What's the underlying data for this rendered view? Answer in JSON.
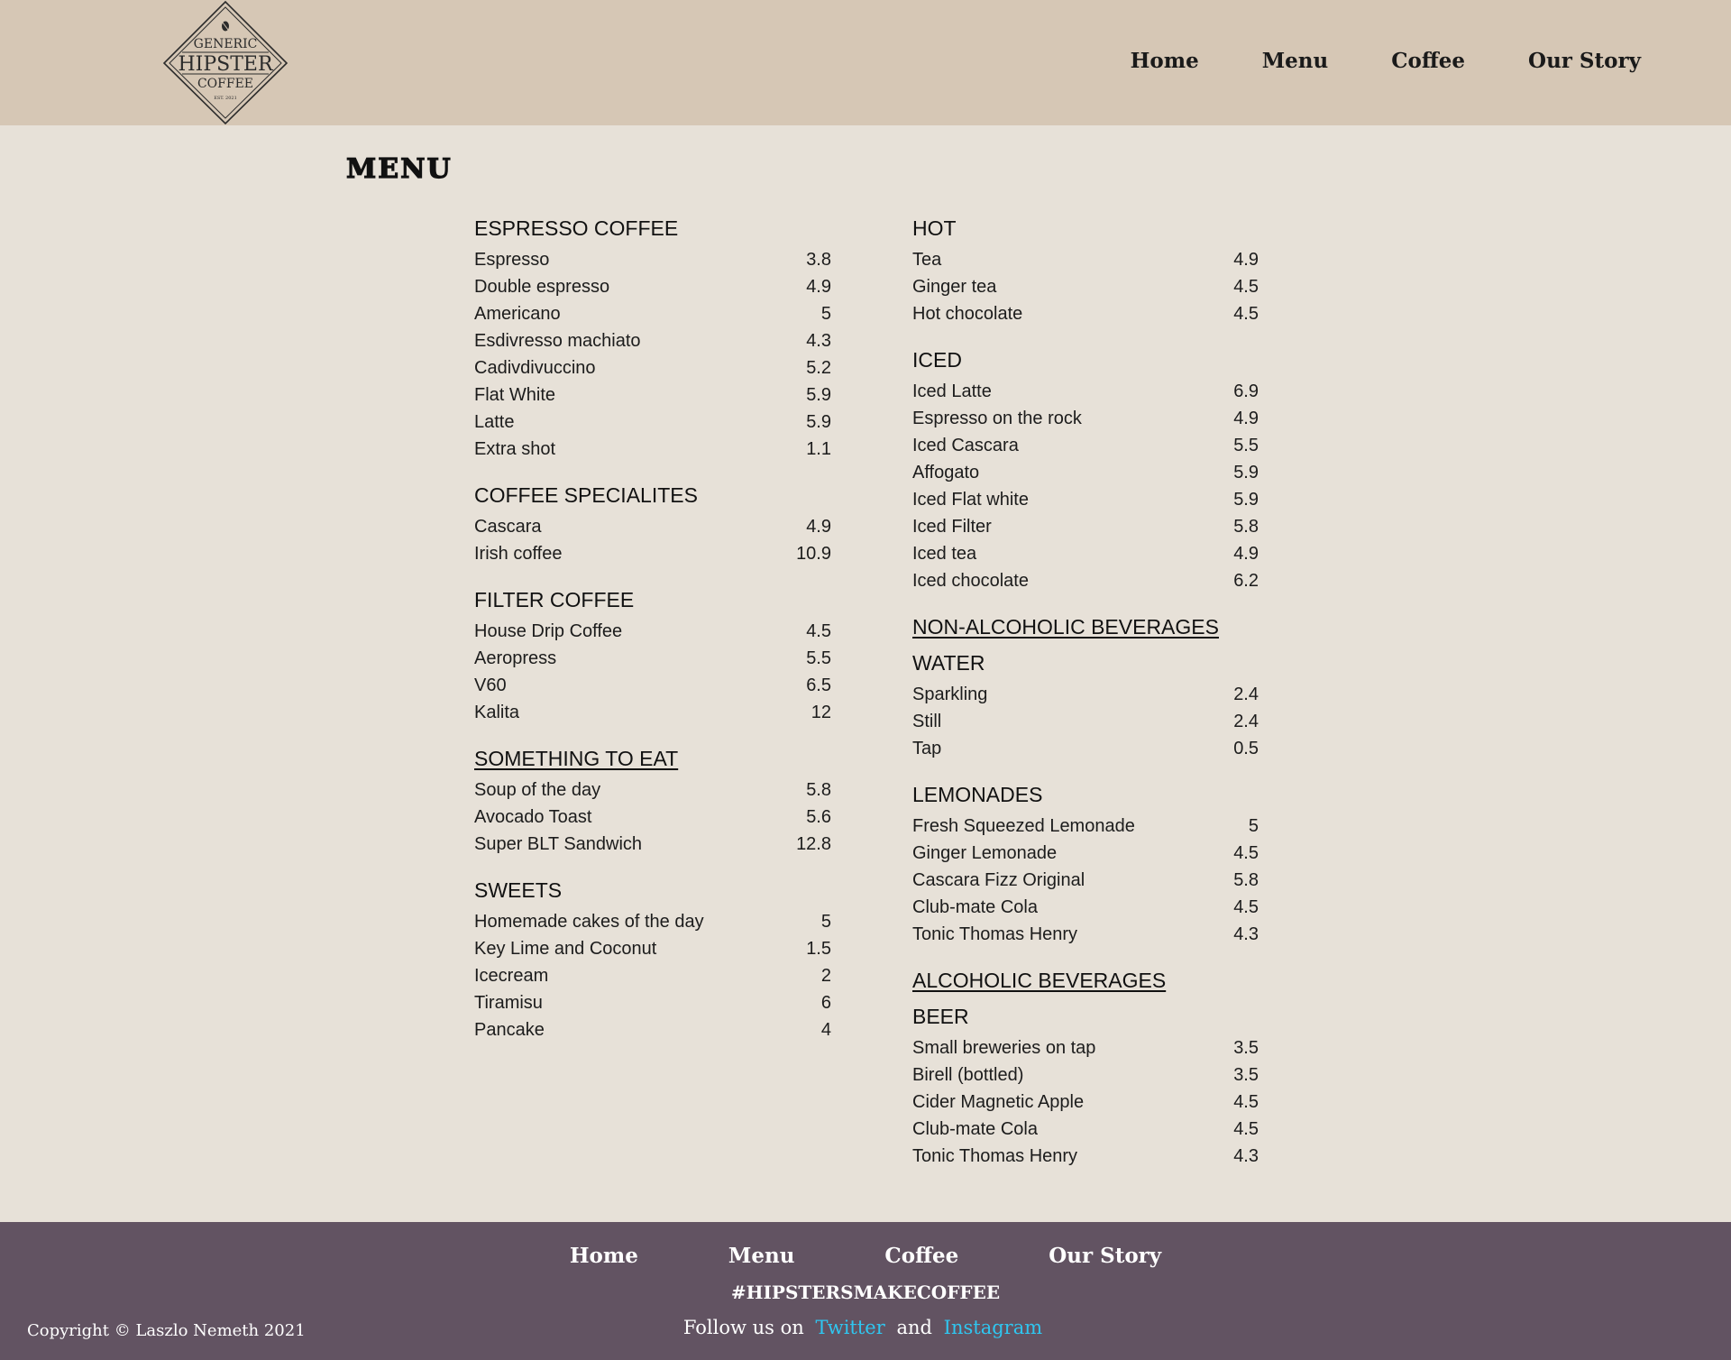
{
  "logo": {
    "line1": "GENERIC",
    "line2": "HIPSTER",
    "line3": "COFFEE",
    "est": "EST. 2021"
  },
  "nav": [
    "Home",
    "Menu",
    "Coffee",
    "Our Story"
  ],
  "title": "MENU",
  "left_column": [
    {
      "heading": "ESPRESSO COFFEE",
      "style": "plain",
      "items": [
        {
          "name": "Espresso",
          "price": "3.8"
        },
        {
          "name": "Double espresso",
          "price": "4.9"
        },
        {
          "name": "Americano",
          "price": "5"
        },
        {
          "name": "Esdivresso machiato",
          "price": "4.3"
        },
        {
          "name": "Cadivdivuccino",
          "price": "5.2"
        },
        {
          "name": "Flat White",
          "price": "5.9"
        },
        {
          "name": "Latte",
          "price": "5.9"
        },
        {
          "name": "Extra shot",
          "price": "1.1"
        }
      ]
    },
    {
      "heading": "COFFEE SPECIALITES",
      "style": "plain",
      "items": [
        {
          "name": "Cascara",
          "price": "4.9"
        },
        {
          "name": "Irish coffee",
          "price": "10.9"
        }
      ]
    },
    {
      "heading": "FILTER COFFEE",
      "style": "plain",
      "items": [
        {
          "name": "House Drip Coffee",
          "price": "4.5"
        },
        {
          "name": "Aeropress",
          "price": "5.5"
        },
        {
          "name": "V60",
          "price": "6.5"
        },
        {
          "name": "Kalita",
          "price": "12"
        }
      ]
    },
    {
      "heading": "SOMETHING TO EAT",
      "style": "underlined",
      "items": [
        {
          "name": "Soup of the day",
          "price": "5.8"
        },
        {
          "name": "Avocado Toast",
          "price": "5.6"
        },
        {
          "name": "Super BLT Sandwich",
          "price": "12.8"
        }
      ]
    },
    {
      "heading": "SWEETS",
      "style": "plain",
      "items": [
        {
          "name": "Homemade cakes of the day",
          "price": "5"
        },
        {
          "name": "Key Lime and Coconut",
          "price": "1.5"
        },
        {
          "name": "Icecream",
          "price": "2"
        },
        {
          "name": "Tiramisu",
          "price": "6"
        },
        {
          "name": "Pancake",
          "price": "4"
        }
      ]
    }
  ],
  "right_column": [
    {
      "heading": "HOT",
      "style": "plain",
      "items": [
        {
          "name": "Tea",
          "price": "4.9"
        },
        {
          "name": "Ginger tea",
          "price": "4.5"
        },
        {
          "name": "Hot chocolate",
          "price": "4.5"
        }
      ]
    },
    {
      "heading": "ICED",
      "style": "plain",
      "items": [
        {
          "name": "Iced Latte",
          "price": "6.9"
        },
        {
          "name": "Espresso on the rock",
          "price": "4.9"
        },
        {
          "name": "Iced Cascara",
          "price": "5.5"
        },
        {
          "name": "Affogato",
          "price": "5.9"
        },
        {
          "name": "Iced Flat white",
          "price": "5.9"
        },
        {
          "name": "Iced Filter",
          "price": "5.8"
        },
        {
          "name": "Iced tea",
          "price": "4.9"
        },
        {
          "name": "Iced chocolate",
          "price": "6.2"
        }
      ]
    },
    {
      "heading": "NON-ALCOHOLIC BEVERAGES",
      "style": "group",
      "items": []
    },
    {
      "heading": "WATER",
      "style": "plain",
      "items": [
        {
          "name": "Sparkling",
          "price": "2.4"
        },
        {
          "name": "Still",
          "price": "2.4"
        },
        {
          "name": "Tap",
          "price": "0.5"
        }
      ]
    },
    {
      "heading": "LEMONADES",
      "style": "plain",
      "items": [
        {
          "name": "Fresh Squeezed Lemonade",
          "price": "5"
        },
        {
          "name": "Ginger Lemonade",
          "price": "4.5"
        },
        {
          "name": "Cascara Fizz Original",
          "price": "5.8"
        },
        {
          "name": "Club-mate Cola",
          "price": "4.5"
        },
        {
          "name": "Tonic Thomas Henry",
          "price": "4.3"
        }
      ]
    },
    {
      "heading": "ALCOHOLIC BEVERAGES",
      "style": "group",
      "items": []
    },
    {
      "heading": "BEER",
      "style": "plain",
      "items": [
        {
          "name": "Small breweries on tap",
          "price": "3.5"
        },
        {
          "name": "Birell (bottled)",
          "price": "3.5"
        },
        {
          "name": "Cider Magnetic Apple",
          "price": "4.5"
        },
        {
          "name": "Club-mate Cola",
          "price": "4.5"
        },
        {
          "name": "Tonic Thomas Henry",
          "price": "4.3"
        }
      ]
    }
  ],
  "footer": {
    "nav": [
      "Home",
      "Menu",
      "Coffee",
      "Our Story"
    ],
    "hashtag": "#HIPSTERSMAKECOFFEE",
    "follow_prefix": "Follow us on",
    "twitter": "Twitter",
    "and": "and",
    "instagram": "Instagram",
    "copyright": "Copyright © Laszlo Nemeth 2021"
  }
}
